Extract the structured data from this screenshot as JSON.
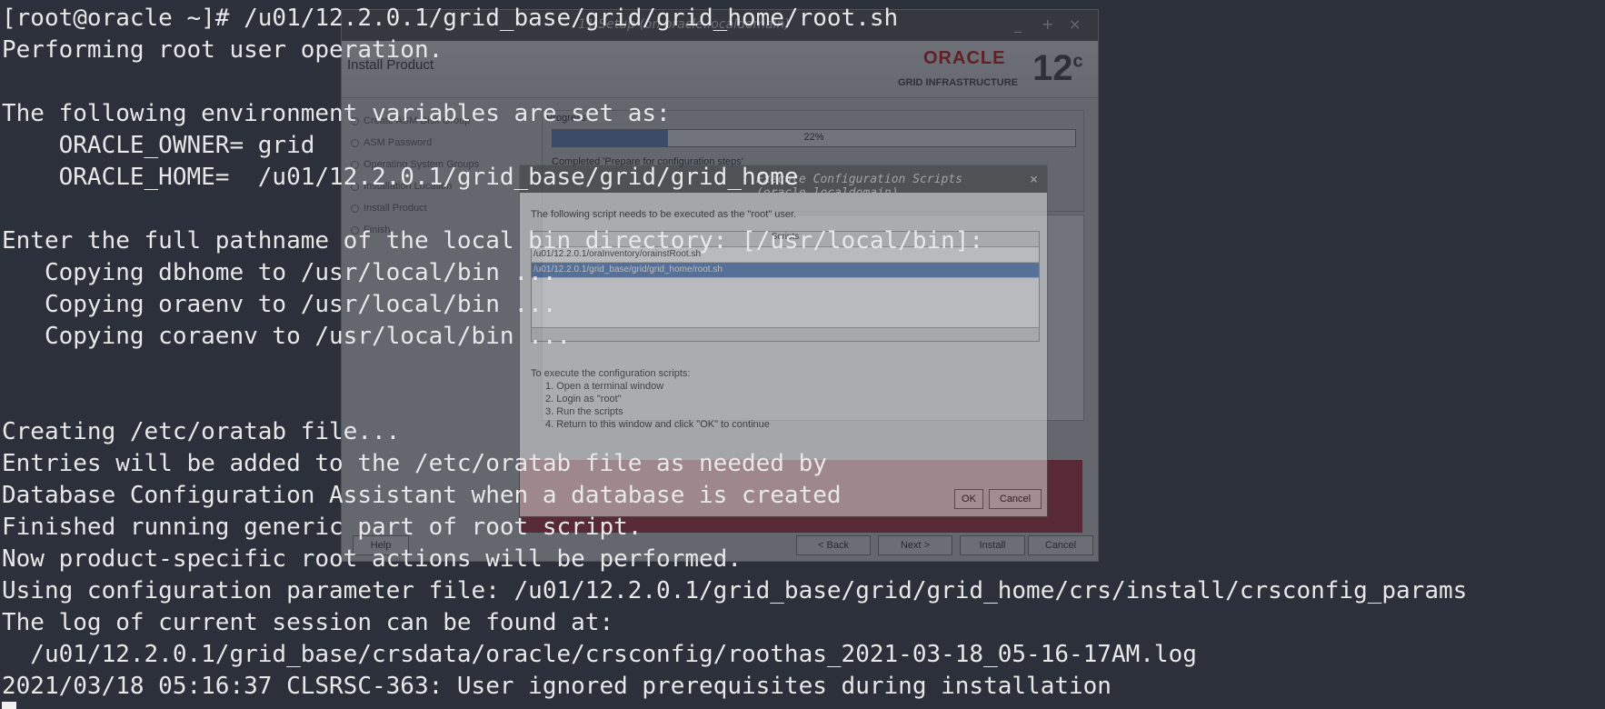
{
  "installer": {
    "title": "11 Setup (on oracle.localdomain)",
    "minimize": "_",
    "maximize": "+",
    "close": "×",
    "step_title": "Install Product",
    "logo_brand": "ORACLE",
    "logo_product": "GRID INFRASTRUCTURE",
    "logo_version": "12",
    "logo_version_suffix": "c",
    "steps": [
      "Create ASM Disk Group",
      "ASM Password",
      "Operating System Groups",
      "Installation Location",
      "Install Product",
      "Finish"
    ],
    "progress_label": "Progress",
    "progress_value": 22,
    "progress_text": "22%",
    "status": "Completed 'Prepare for configuration steps'",
    "buttons": {
      "help": "Help",
      "back": "< Back",
      "next": "Next >",
      "install": "Install",
      "cancel": "Cancel"
    }
  },
  "dialog": {
    "title": "Execute Configuration Scripts (oracle.localdomain)",
    "close": "×",
    "message": "The following script needs to be executed as the \"root\" user.",
    "table_header": "Scripts",
    "scripts": [
      "/u01/12.2.0.1/oraInventory/orainstRoot.sh",
      "/u01/12.2.0.1/grid_base/grid/grid_home/root.sh"
    ],
    "instructions_title": "To execute the configuration scripts:",
    "instructions": [
      "1. Open a terminal window",
      "2. Login as \"root\"",
      "3. Run the scripts",
      "4. Return to this window and click \"OK\" to continue"
    ],
    "ok": "OK",
    "cancel": "Cancel"
  },
  "terminal": {
    "lines": [
      "[root@oracle ~]# /u01/12.2.0.1/grid_base/grid/grid_home/root.sh",
      "Performing root user operation.",
      "",
      "The following environment variables are set as:",
      "    ORACLE_OWNER= grid",
      "    ORACLE_HOME=  /u01/12.2.0.1/grid_base/grid/grid_home",
      "",
      "Enter the full pathname of the local bin directory: [/usr/local/bin]:",
      "   Copying dbhome to /usr/local/bin ...",
      "   Copying oraenv to /usr/local/bin ...",
      "   Copying coraenv to /usr/local/bin ...",
      "",
      "",
      "Creating /etc/oratab file...",
      "Entries will be added to the /etc/oratab file as needed by",
      "Database Configuration Assistant when a database is created",
      "Finished running generic part of root script.",
      "Now product-specific root actions will be performed.",
      "Using configuration parameter file: /u01/12.2.0.1/grid_base/grid/grid_home/crs/install/crsconfig_params",
      "The log of current session can be found at:",
      "  /u01/12.2.0.1/grid_base/crsdata/oracle/crsconfig/roothas_2021-03-18_05-16-17AM.log",
      "2021/03/18 05:16:37 CLSRSC-363: User ignored prerequisites during installation"
    ]
  },
  "colors": {
    "terminal_bg": "#2b303a",
    "terminal_fg": "#e8e8e8",
    "oracle_red": "#c00000",
    "selection_blue": "#3d6fb6"
  }
}
